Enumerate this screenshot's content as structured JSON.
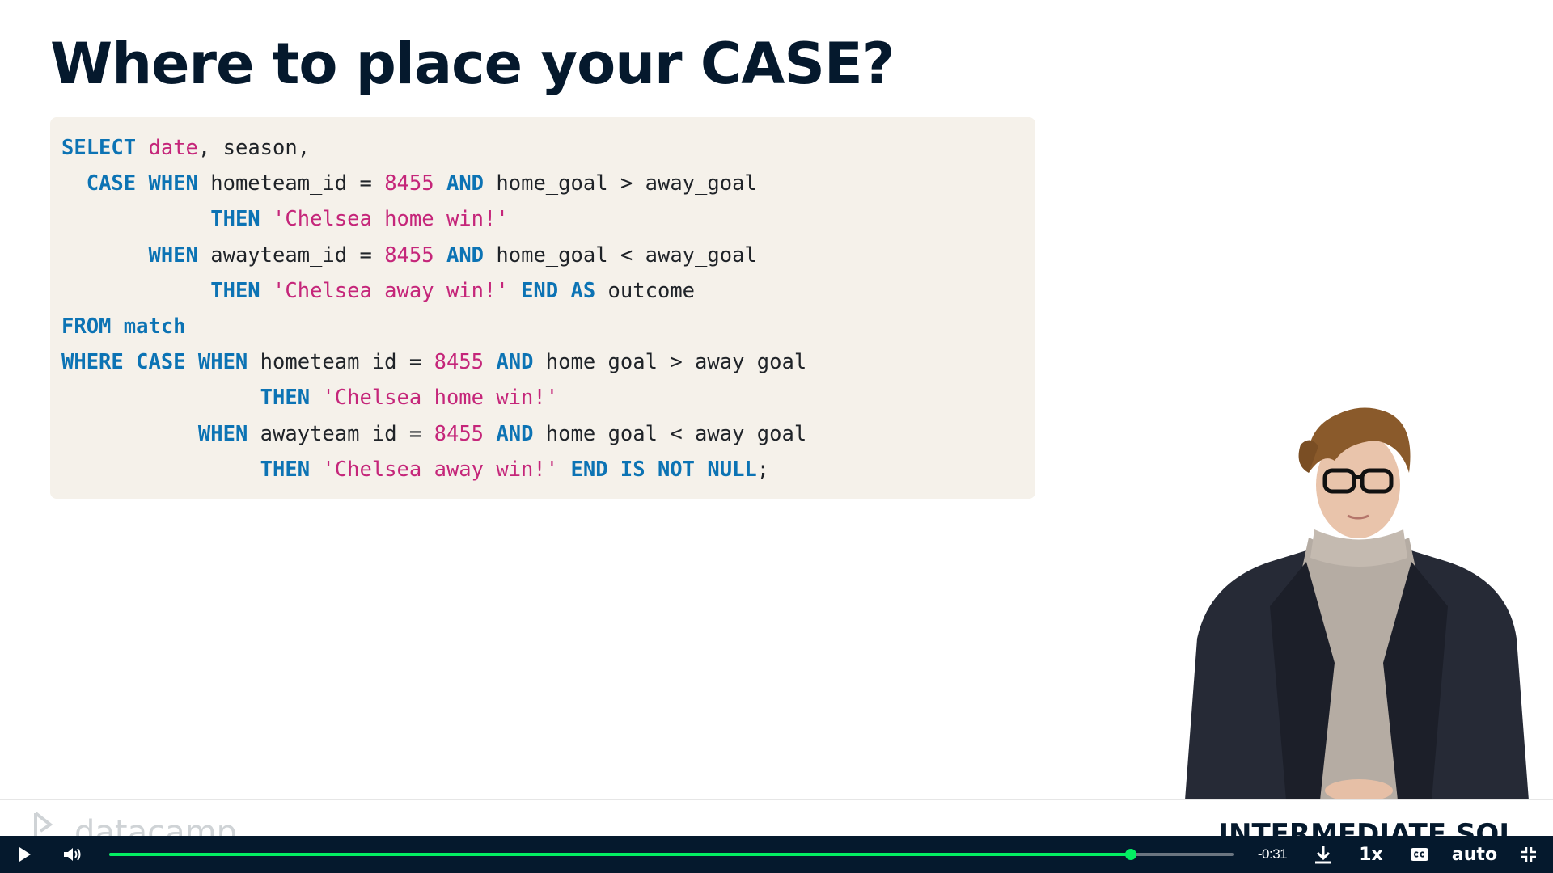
{
  "slide": {
    "title": "Where to place your CASE?",
    "code_lines": [
      [
        {
          "t": "kw",
          "v": "SELECT"
        },
        {
          "t": "pl",
          "v": " "
        },
        {
          "t": "id",
          "v": "date"
        },
        {
          "t": "pl",
          "v": ", season,"
        }
      ],
      [
        {
          "t": "pl",
          "v": "  "
        },
        {
          "t": "kw",
          "v": "CASE WHEN"
        },
        {
          "t": "pl",
          "v": " hometeam_id = "
        },
        {
          "t": "num",
          "v": "8455"
        },
        {
          "t": "pl",
          "v": " "
        },
        {
          "t": "kw",
          "v": "AND"
        },
        {
          "t": "pl",
          "v": " home_goal > away_goal"
        }
      ],
      [
        {
          "t": "pl",
          "v": "            "
        },
        {
          "t": "kw",
          "v": "THEN"
        },
        {
          "t": "pl",
          "v": " "
        },
        {
          "t": "str",
          "v": "'Chelsea home win!'"
        }
      ],
      [
        {
          "t": "pl",
          "v": "       "
        },
        {
          "t": "kw",
          "v": "WHEN"
        },
        {
          "t": "pl",
          "v": " awayteam_id = "
        },
        {
          "t": "num",
          "v": "8455"
        },
        {
          "t": "pl",
          "v": " "
        },
        {
          "t": "kw",
          "v": "AND"
        },
        {
          "t": "pl",
          "v": " home_goal < away_goal"
        }
      ],
      [
        {
          "t": "pl",
          "v": "            "
        },
        {
          "t": "kw",
          "v": "THEN"
        },
        {
          "t": "pl",
          "v": " "
        },
        {
          "t": "str",
          "v": "'Chelsea away win!'"
        },
        {
          "t": "pl",
          "v": " "
        },
        {
          "t": "kw",
          "v": "END AS"
        },
        {
          "t": "pl",
          "v": " outcome"
        }
      ],
      [
        {
          "t": "kw",
          "v": "FROM match"
        }
      ],
      [
        {
          "t": "kw",
          "v": "WHERE CASE WHEN"
        },
        {
          "t": "pl",
          "v": " hometeam_id = "
        },
        {
          "t": "num",
          "v": "8455"
        },
        {
          "t": "pl",
          "v": " "
        },
        {
          "t": "kw",
          "v": "AND"
        },
        {
          "t": "pl",
          "v": " home_goal > away_goal"
        }
      ],
      [
        {
          "t": "pl",
          "v": "                "
        },
        {
          "t": "kw",
          "v": "THEN"
        },
        {
          "t": "pl",
          "v": " "
        },
        {
          "t": "str",
          "v": "'Chelsea home win!'"
        }
      ],
      [
        {
          "t": "pl",
          "v": "           "
        },
        {
          "t": "kw",
          "v": "WHEN"
        },
        {
          "t": "pl",
          "v": " awayteam_id = "
        },
        {
          "t": "num",
          "v": "8455"
        },
        {
          "t": "pl",
          "v": " "
        },
        {
          "t": "kw",
          "v": "AND"
        },
        {
          "t": "pl",
          "v": " home_goal < away_goal"
        }
      ],
      [
        {
          "t": "pl",
          "v": "                "
        },
        {
          "t": "kw",
          "v": "THEN"
        },
        {
          "t": "pl",
          "v": " "
        },
        {
          "t": "str",
          "v": "'Chelsea away win!'"
        },
        {
          "t": "pl",
          "v": " "
        },
        {
          "t": "kw",
          "v": "END IS NOT NULL"
        },
        {
          "t": "pl",
          "v": ";"
        }
      ]
    ]
  },
  "footer": {
    "brand": "datacamp",
    "course": "INTERMEDIATE SQL"
  },
  "player": {
    "time_remaining": "-0:31",
    "speed": "1x",
    "quality": "auto",
    "progress_fraction": 0.9085,
    "icons": {
      "play": "play-icon",
      "volume": "volume-icon",
      "download": "download-icon",
      "captions": "captions-icon",
      "exit_fullscreen": "exit-fullscreen-icon"
    }
  },
  "colors": {
    "title": "#05192d",
    "keyword": "#0c73b4",
    "literal": "#c5267a",
    "code_bg": "#f5f1ea",
    "progress": "#03ef62",
    "player_bg": "#05192d"
  }
}
